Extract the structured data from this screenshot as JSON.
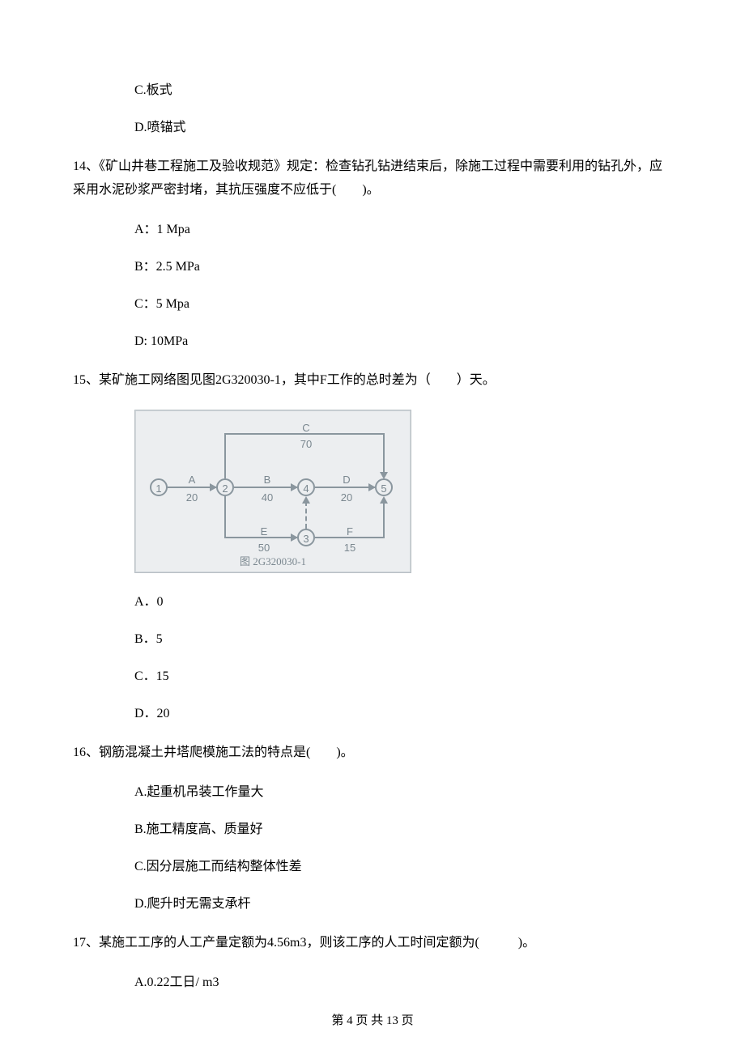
{
  "q13": {
    "optC": "C.板式",
    "optD": "D.喷锚式"
  },
  "q14": {
    "text": "14、《矿山井巷工程施工及验收规范》规定：检查钻孔钻进结束后，除施工过程中需要利用的钻孔外，应采用水泥砂浆严密封堵，其抗压强度不应低于(　　)。",
    "optA": "A：1 Mpa",
    "optB": "B：2.5 MPa",
    "optC": "C：5 Mpa",
    "optD": "D: 10MPa"
  },
  "q15": {
    "text": "15、某矿施工网络图见图2G320030-1，其中F工作的总时差为（　　）天。",
    "optA": "A．0",
    "optB": "B．5",
    "optC": "C．15",
    "optD": "D．20"
  },
  "q16": {
    "text": "16、钢筋混凝土井塔爬模施工法的特点是(　　)。",
    "optA": "A.起重机吊装工作量大",
    "optB": "B.施工精度高、质量好",
    "optC": "C.因分层施工而结构整体性差",
    "optD": "D.爬升时无需支承杆"
  },
  "q17": {
    "text": "17、某施工工序的人工产量定额为4.56m3，则该工序的人工时间定额为(　　　)。",
    "optA": "A.0.22工日/ m3"
  },
  "figure": {
    "caption": "图 2G320030-1",
    "nodes": {
      "n1": "1",
      "n2": "2",
      "n3": "3",
      "n4": "4",
      "n5": "5"
    },
    "edges": {
      "A": {
        "label": "A",
        "value": "20"
      },
      "B": {
        "label": "B",
        "value": "40"
      },
      "C": {
        "label": "C",
        "value": "70"
      },
      "D": {
        "label": "D",
        "value": "20"
      },
      "E": {
        "label": "E",
        "value": "50"
      },
      "F": {
        "label": "F",
        "value": "15"
      }
    }
  },
  "chart_data": {
    "type": "network-diagram",
    "title": "图 2G320030-1",
    "nodes": [
      1,
      2,
      3,
      4,
      5
    ],
    "activities": [
      {
        "name": "A",
        "from": 1,
        "to": 2,
        "duration": 20
      },
      {
        "name": "B",
        "from": 2,
        "to": 4,
        "duration": 40
      },
      {
        "name": "C",
        "from": 2,
        "to": 5,
        "duration": 70
      },
      {
        "name": "D",
        "from": 4,
        "to": 5,
        "duration": 20
      },
      {
        "name": "E",
        "from": 2,
        "to": 3,
        "duration": 50
      },
      {
        "name": "F",
        "from": 3,
        "to": 5,
        "duration": 15
      },
      {
        "name": "dummy",
        "from": 3,
        "to": 4,
        "duration": 0,
        "dashed": true
      }
    ]
  },
  "footer": "第 4 页 共 13 页"
}
